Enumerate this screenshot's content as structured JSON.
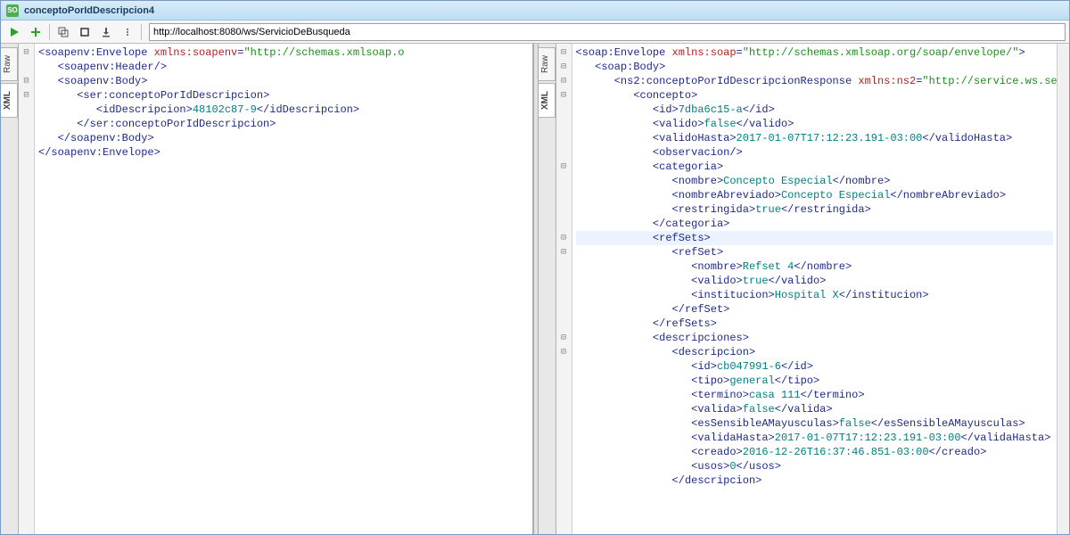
{
  "window": {
    "title": "conceptoPorIdDescripcion4"
  },
  "toolbar": {
    "url": "http://localhost:8080/ws/ServicioDeBusqueda"
  },
  "side_tabs": {
    "raw": "Raw",
    "xml": "XML"
  },
  "request": {
    "envelope_open": "soapenv:Envelope",
    "xmlns_attr": "xmlns:soapenv",
    "xmlns_val": "http://schemas.xmlsoap.o",
    "header": "soapenv:Header",
    "body_open": "soapenv:Body",
    "op": "ser:conceptoPorIdDescripcion",
    "idDesc_tag": "idDescripcion",
    "idDesc_val": "48102c87-9"
  },
  "response": {
    "envelope_open": "soap:Envelope",
    "xmlns_attr": "xmlns:soap",
    "xmlns_val": "http://schemas.xmlsoap.org/soap/envelope/",
    "body_open": "soap:Body",
    "op": "ns2:conceptoPorIdDescripcionResponse",
    "ns2_attr": "xmlns:ns2",
    "ns2_val": "http://service.ws.sema",
    "concepto": "concepto",
    "id_tag": "id",
    "id_val": "7dba6c15-a",
    "valido_tag": "valido",
    "valido_val": "false",
    "validoHasta_tag": "validoHasta",
    "validoHasta_val": "2017-01-07T17:12:23.191-03:00",
    "observacion_tag": "observacion",
    "categoria": "categoria",
    "cat_nombre_tag": "nombre",
    "cat_nombre_val": "Concepto Especial",
    "cat_nombreAbrev_tag": "nombreAbreviado",
    "cat_nombreAbrev_val": "Concepto Especial",
    "cat_restr_tag": "restringida",
    "cat_restr_val": "true",
    "refSets": "refSets",
    "refSet": "refSet",
    "rs_nombre_tag": "nombre",
    "rs_nombre_val": "Refset 4",
    "rs_valido_tag": "valido",
    "rs_valido_val": "true",
    "rs_inst_tag": "institucion",
    "rs_inst_val": "Hospital X",
    "descripciones": "descripciones",
    "descripcion": "descripcion",
    "d_id_tag": "id",
    "d_id_val": "cb047991-6",
    "d_tipo_tag": "tipo",
    "d_tipo_val": "general",
    "d_term_tag": "termino",
    "d_term_val": "casa 111",
    "d_valida_tag": "valida",
    "d_valida_val": "false",
    "d_sens_tag": "esSensibleAMayusculas",
    "d_sens_val": "false",
    "d_validaHasta_tag": "validaHasta",
    "d_validaHasta_val": "2017-01-07T17:12:23.191-03:00",
    "d_creado_tag": "creado",
    "d_creado_val": "2016-12-26T16:37:46.851-03:00",
    "d_usos_tag": "usos",
    "d_usos_val": "0"
  }
}
